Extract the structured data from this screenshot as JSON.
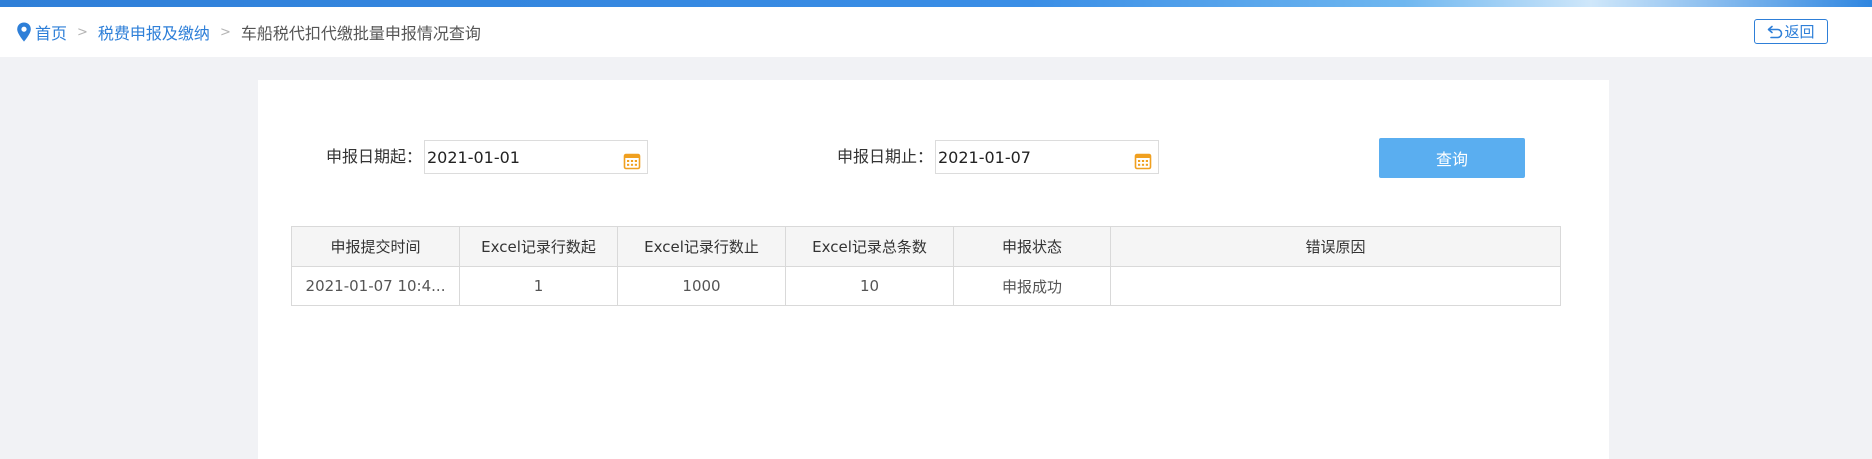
{
  "breadcrumb": {
    "home": "首页",
    "separator": ">",
    "level1": "税费申报及缴纳",
    "current": "车船税代扣代缴批量申报情况查询"
  },
  "back_button": {
    "label": "返回"
  },
  "form": {
    "start_label": "申报日期起：",
    "start_value": "2021-01-01",
    "end_label": "申报日期止：",
    "end_value": "2021-01-07",
    "query_label": "查询"
  },
  "table": {
    "headers": [
      "申报提交时间",
      "Excel记录行数起",
      "Excel记录行数止",
      "Excel记录总条数",
      "申报状态",
      "错误原因"
    ],
    "rows": [
      [
        "2021-01-07 10:4...",
        "1",
        "1000",
        "10",
        "申报成功",
        ""
      ]
    ]
  },
  "colors": {
    "accent": "#2e7fd8",
    "button": "#5aaef0",
    "calendar_icon": "#f0a020"
  },
  "icons": {
    "home": "location-pin-icon",
    "back": "return-arrow-icon",
    "calendar": "calendar-icon"
  }
}
